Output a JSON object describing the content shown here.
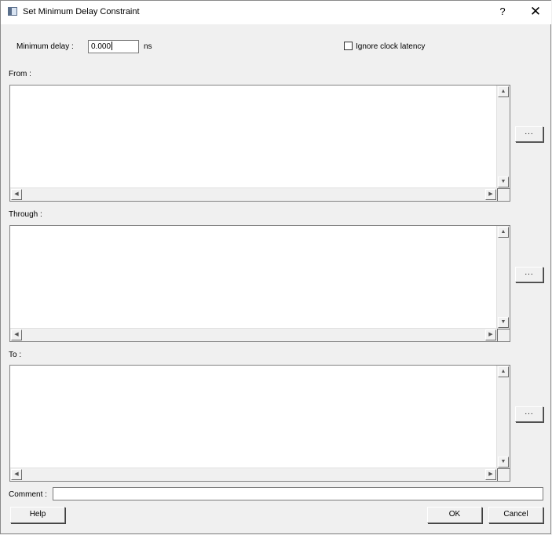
{
  "window": {
    "title": "Set Minimum Delay Constraint",
    "help_label": "?",
    "close_label": "✕"
  },
  "delay": {
    "label": "Minimum delay :",
    "value": "0.000",
    "unit": "ns"
  },
  "ignore_clock_latency": {
    "label": "Ignore clock latency",
    "checked": false
  },
  "from": {
    "label": "From :",
    "browse_label": "..."
  },
  "through": {
    "label": "Through :",
    "browse_label": "..."
  },
  "to": {
    "label": "To :",
    "browse_label": "..."
  },
  "comment": {
    "label": "Comment :",
    "value": ""
  },
  "buttons": {
    "help": "Help",
    "ok": "OK",
    "cancel": "Cancel"
  },
  "scroll_arrows": {
    "up": "▲",
    "down": "▼",
    "left": "◀",
    "right": "▶"
  }
}
